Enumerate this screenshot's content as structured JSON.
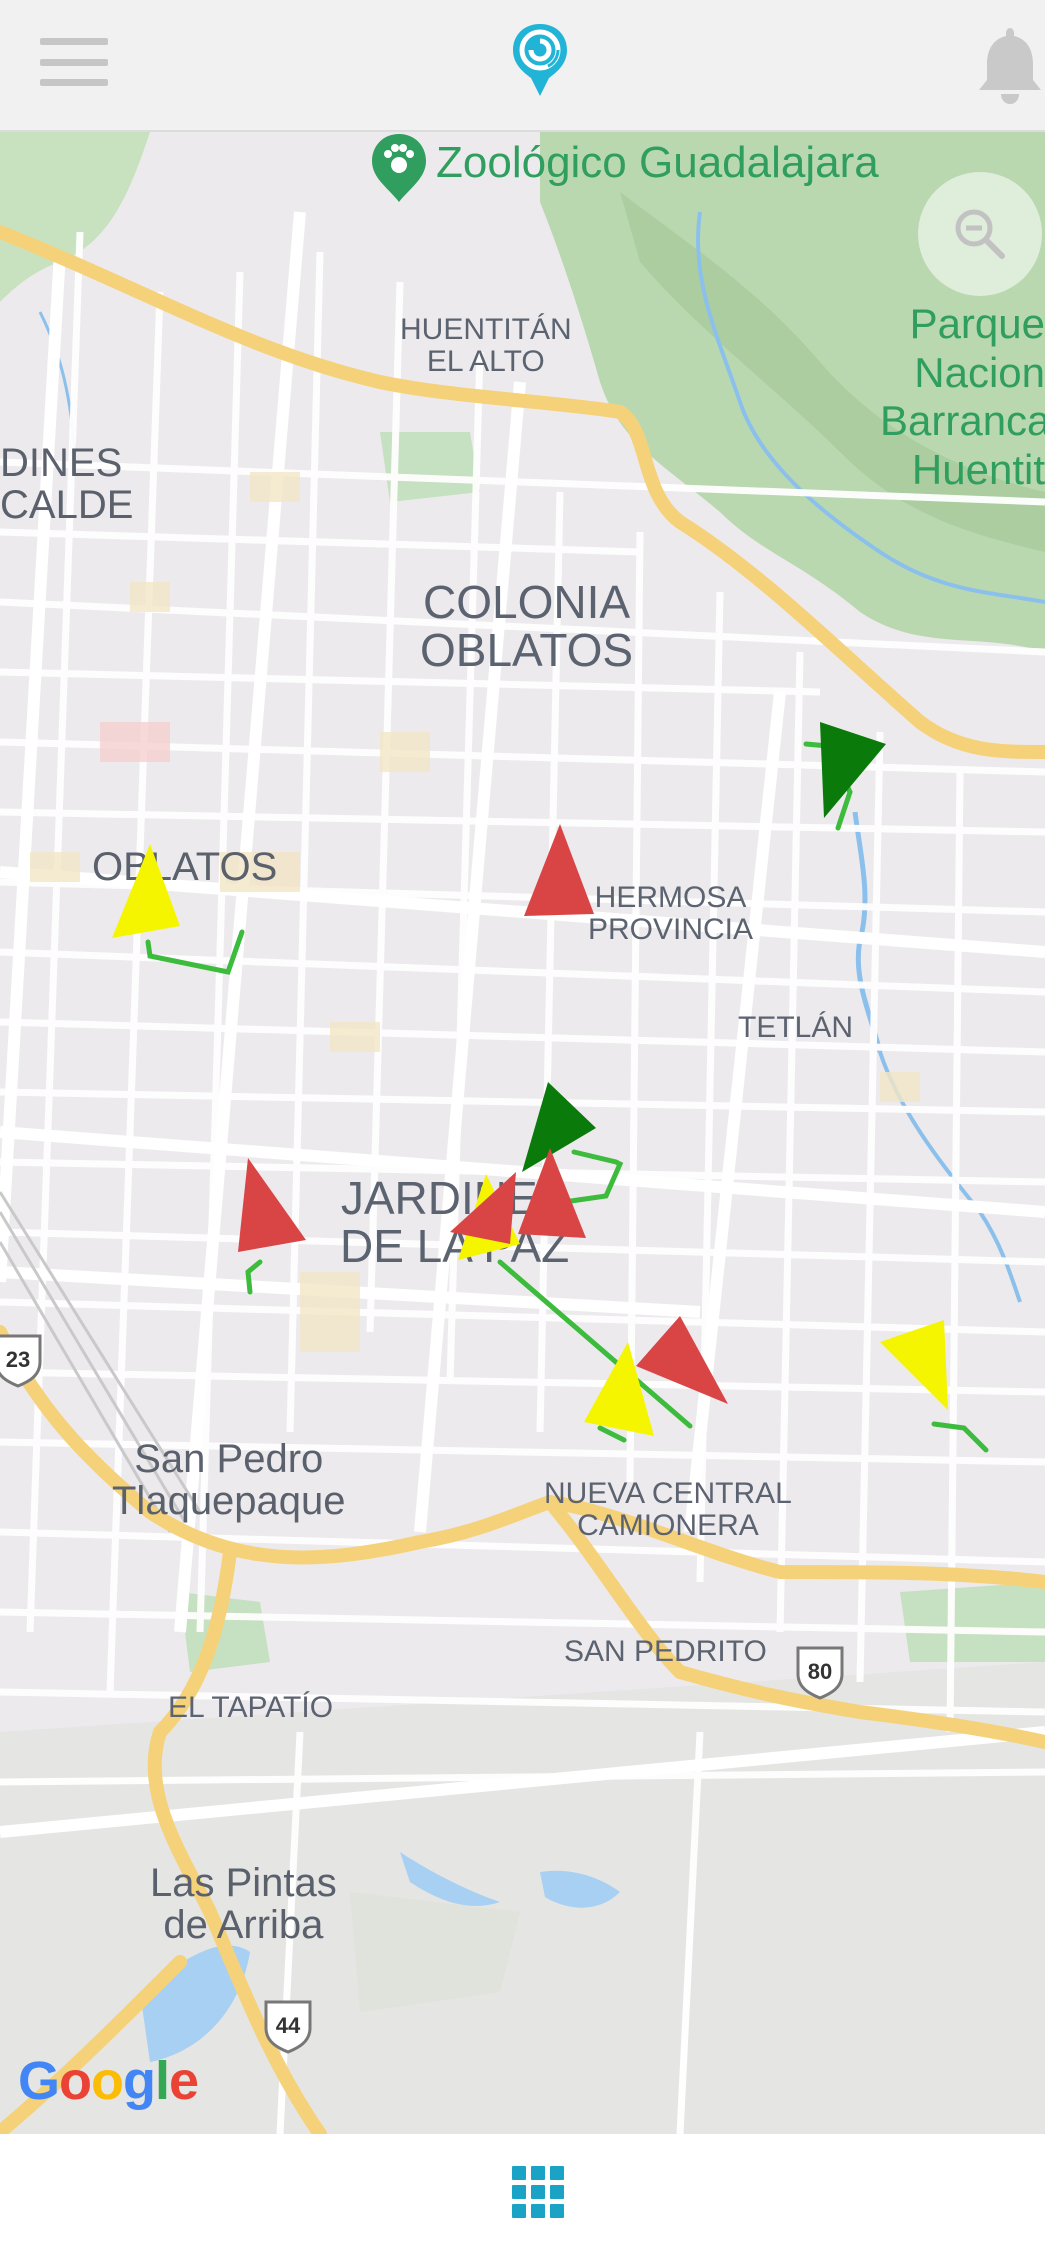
{
  "header": {
    "menu_icon": "hamburger-menu-icon",
    "logo_icon": "location-pin-logo-icon",
    "notifications_icon": "bell-icon"
  },
  "map": {
    "poi_zoo": "Zoológico Guadalajara",
    "park": [
      "Parque",
      "Nacion",
      "Barranca",
      "Huentit"
    ],
    "neighborhoods": {
      "huentitan": [
        "HUENTITÁN",
        "EL ALTO"
      ],
      "jardines_left": [
        "DINES",
        "CALDE"
      ],
      "colonia_oblatos": [
        "COLONIA",
        "OBLATOS"
      ],
      "oblatos": "OBLATOS",
      "hermosa": [
        "HERMOSA",
        "PROVINCIA"
      ],
      "tetlan": "TETLÁN",
      "jardines_paz": [
        "JARDINES",
        "DE LA PAZ"
      ],
      "san_pedro": [
        "San Pedro",
        "Tlaquepaque"
      ],
      "central": [
        "NUEVA CENTRAL",
        "CAMIONERA"
      ],
      "san_pedrito": "SAN PEDRITO",
      "tapatio": "EL TAPATÍO",
      "pintas": [
        "Las Pintas",
        "de Arriba"
      ]
    },
    "route_shields": [
      "23",
      "80",
      "44"
    ],
    "attribution": "Google",
    "search_icon": "zoom-out-magnifier-icon",
    "vehicle_colors": {
      "red": "#d94545",
      "yellow": "#f5f500",
      "green": "#0a7a0a",
      "trail": "#3dbb3d"
    }
  },
  "footer": {
    "apps_icon": "grid-apps-icon"
  }
}
